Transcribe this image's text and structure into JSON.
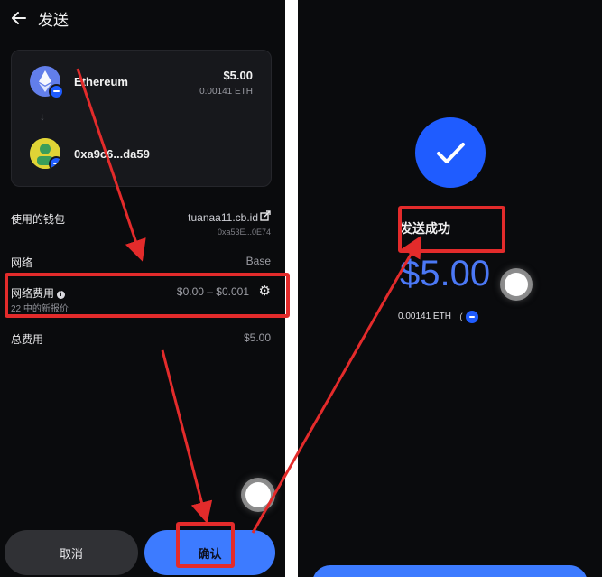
{
  "send_screen": {
    "header": {
      "title": "发送"
    },
    "from": {
      "name": "Ethereum",
      "amount_usd": "$5.00",
      "amount_eth": "0.00141 ETH"
    },
    "arrow_glyph": "↓",
    "to": {
      "address": "0xa9c6...da59"
    },
    "wallet": {
      "label": "使用的钱包",
      "name": "tuanaa11.cb.id",
      "address": "0xa53E...0E74"
    },
    "network": {
      "label": "网络",
      "value": "Base"
    },
    "fee": {
      "label": "网络费用",
      "range": "$0.00 – $0.001",
      "note": "22 中的新报价"
    },
    "total": {
      "label": "总费用",
      "value": "$5.00"
    },
    "buttons": {
      "cancel": "取消",
      "confirm": "确认"
    }
  },
  "success_screen": {
    "title": "发送成功",
    "amount_usd": "$5.00",
    "amount_eth": "0.00141 ETH",
    "paren_open": "（"
  },
  "colors": {
    "background": "#0a0b0d",
    "accent_blue": "#1f5cff",
    "button_blue": "#3d7bff",
    "annotation_red": "#e32b2b"
  },
  "icons": {
    "back": "back-arrow-icon",
    "ethereum": "ethereum-icon",
    "network_badge": "base-network-icon",
    "external_link": "external-link-icon",
    "info": "info-icon",
    "settings": "gear-icon",
    "success": "check-icon"
  }
}
